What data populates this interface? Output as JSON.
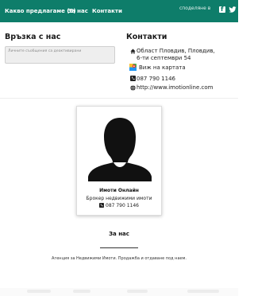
{
  "navbar": {
    "links": [
      "Какво предлагаме (6)",
      "За нас",
      "Контакти"
    ],
    "share_label": "споделяне в",
    "color": "#0e7d6a"
  },
  "contact_form": {
    "title": "Връзка с нас",
    "message_placeholder": "Личните съобщения са деактивирани"
  },
  "contacts": {
    "title": "Контакти",
    "address_line1": "Област Пловдив, Пловдив,",
    "address_line2": "6-ти септември 54",
    "map_link": "Виж на картата",
    "phone": "087 790 1146",
    "website": "http://www.imotionline.com"
  },
  "agent": {
    "name": "Имоти Онлайн",
    "role": "Брокер недвижими имоти",
    "phone": "087 790 1146"
  },
  "about": {
    "title": "За нас",
    "text": "Агенция за Недвижими Имоти. Продажба и отдаване под наем."
  }
}
